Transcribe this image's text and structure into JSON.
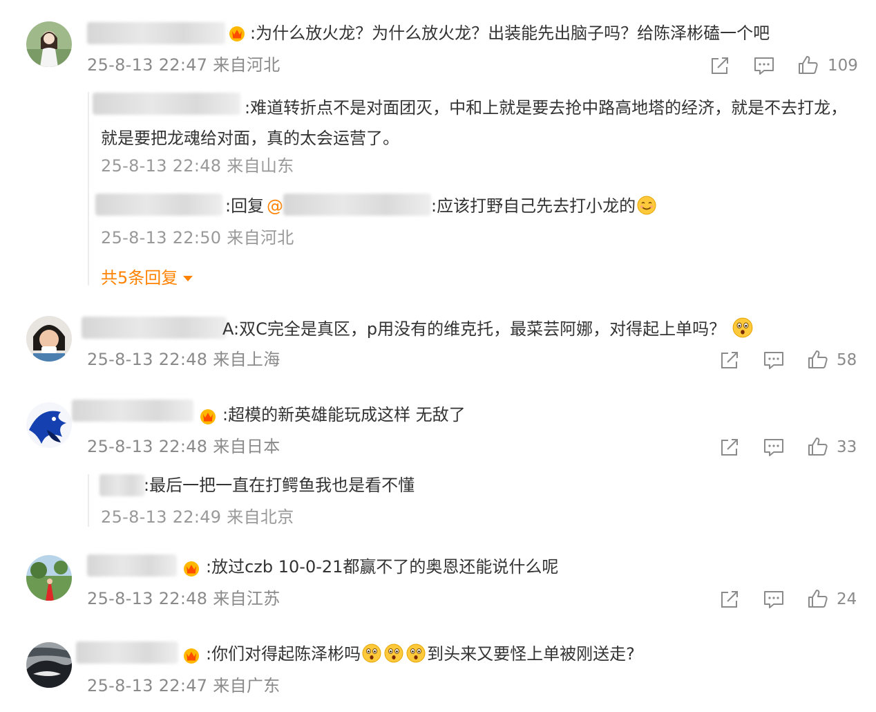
{
  "comments": [
    {
      "text": ":为什么放火龙？为什么放火龙？出装能先出脑子吗？给陈泽彬磕一个吧",
      "time": "25-8-13 22:47 来自河北",
      "likes": "109",
      "replies": [
        {
          "text": ":难道转折点不是对面团灭，中和上就是要去抢中路高地塔的经济，就是不去打龙，就是要把龙魂给对面，真的太会运营了。",
          "time": "25-8-13 22:48 来自山东"
        },
        {
          "text_a": ":回复",
          "mention": "@",
          "text_b": ":应该打野自己先去打小龙的",
          "time": "25-8-13 22:50 来自河北"
        }
      ],
      "more_replies": "共5条回复"
    },
    {
      "text": "A:双C完全是真区，p用没有的维克托，最菜芸阿娜，对得起上单吗？",
      "time": "25-8-13 22:48 来自上海",
      "likes": "58"
    },
    {
      "text": ":超模的新英雄能玩成这样 无敌了",
      "time": "25-8-13 22:48 来自日本",
      "likes": "33",
      "replies": [
        {
          "text": ":最后一把一直在打鳄鱼我也是看不懂",
          "time": "25-8-13 22:49 来自北京"
        }
      ]
    },
    {
      "text": ":放过czb 10-0-21都赢不了的奥恩还能说什么呢",
      "time": "25-8-13 22:48 来自江苏",
      "likes": "24"
    },
    {
      "text_a": ":你们对得起陈泽彬吗",
      "text_b": "到头来又要怪上单被刚送走?",
      "time": "25-8-13 22:47 来自广东"
    }
  ],
  "colors": {
    "text": "#333333",
    "meta": "#8a8a8a",
    "accent": "#ff8200",
    "divider": "#ececec"
  },
  "icons": {
    "share": "share-icon",
    "comment": "comment-icon",
    "like": "thumbs-up-icon",
    "crown": "crown-badge-icon",
    "emoji_smile": "smile-emoji",
    "emoji_surprise": "surprised-emoji"
  }
}
